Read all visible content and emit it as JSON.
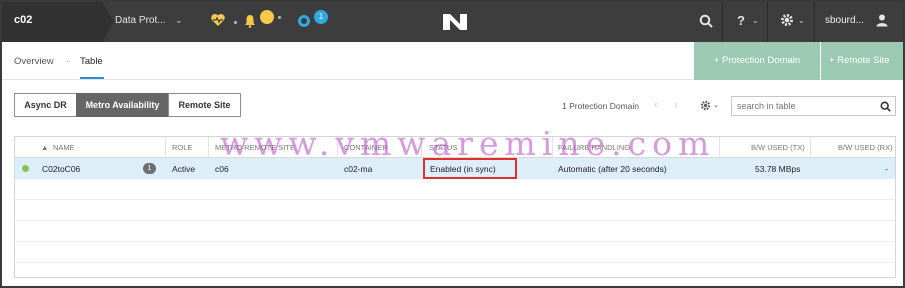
{
  "topbar": {
    "cluster_name": "c02",
    "menu_title": "Data Prot...",
    "menu_chevron": "⌄",
    "alert_badge": "",
    "task_badge": "1",
    "help_label": "?",
    "user_name": "sbourd...",
    "icons": [
      "heart-health-icon",
      "bell-icon",
      "circle-tasks-icon",
      "nutanix-logo",
      "search-icon",
      "help-icon",
      "gear-icon",
      "user-icon"
    ]
  },
  "subbar": {
    "tabs": [
      {
        "label": "Overview"
      },
      {
        "label": "Table"
      }
    ],
    "tab_separator": "·",
    "active_tab": "Table",
    "protection_domain_button": "+ Protection Domain",
    "remote_site_button": "+ Remote Site"
  },
  "toggle": {
    "options": [
      "Async DR",
      "Metro Availability",
      "Remote Site"
    ],
    "selected": "Metro Availability"
  },
  "table_controls": {
    "count_label": "1 Protection Domain",
    "prev": "‹",
    "next": "›",
    "search_placeholder": "search in table"
  },
  "table": {
    "headers": [
      "NAME",
      "ROLE",
      "METRO REMOTE SITE",
      "CONTAINER",
      "STATUS",
      "FAILURE HANDLING",
      "B/W USED (TX)",
      "B/W USED (RX)"
    ],
    "rows": [
      {
        "name": "C02toC06",
        "count_badge": "1",
        "role": "Active",
        "remote_site": "c06",
        "container": "c02-ma",
        "status": "Enabled (in sync)",
        "failure_handling": "Automatic (after 20 seconds)",
        "bw_tx": "53.78 MBps",
        "bw_rx": "-"
      }
    ]
  },
  "watermark": "www.vmwaremine.com",
  "colors": {
    "topbar_bg": "#3d3d3d",
    "accent_green": "#9bc9b4",
    "selected_row": "#ddeef9",
    "highlight_red": "#e0302b",
    "status_green": "#8cc152",
    "tab_underline": "#2a8fd8"
  }
}
